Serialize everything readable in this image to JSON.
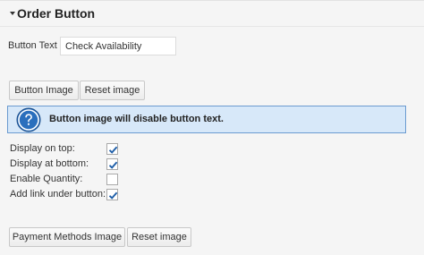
{
  "section": {
    "title": "Order Button"
  },
  "button_text": {
    "label": "Button Text",
    "value": "Check Availability"
  },
  "image_buttons": {
    "button_image": "Button Image",
    "reset_image": "Reset image"
  },
  "notice": {
    "icon": "question-icon",
    "message": "Button image will disable button text."
  },
  "options": [
    {
      "label": "Display on top:",
      "checked": true
    },
    {
      "label": "Display at bottom:",
      "checked": true
    },
    {
      "label": "Enable Quantity:",
      "checked": false
    },
    {
      "label": "Add link under button:",
      "checked": true
    }
  ],
  "bottom_buttons": {
    "payment_methods_image": "Payment Methods Image",
    "reset_image": "Reset image"
  },
  "colors": {
    "notice_bg": "#d7e8f9",
    "notice_border": "#6b9bd0",
    "icon_blue": "#2a6fbd",
    "check_blue": "#1e5ea8"
  }
}
